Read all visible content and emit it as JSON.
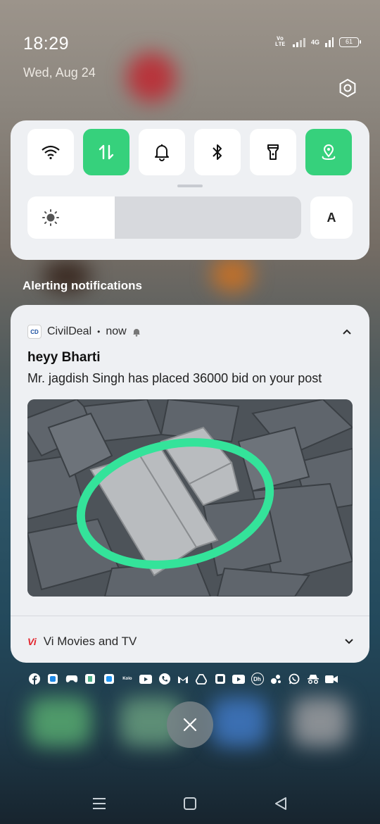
{
  "status_bar": {
    "time": "18:29",
    "date": "Wed, Aug 24",
    "volte": "Vo LTE",
    "network": "4G",
    "battery": "61"
  },
  "quick_settings": {
    "tiles": [
      {
        "name": "wifi",
        "icon": "wifi-icon",
        "active": false
      },
      {
        "name": "mobile-data",
        "icon": "mobile-data-icon",
        "active": true
      },
      {
        "name": "sound",
        "icon": "bell-icon",
        "active": false
      },
      {
        "name": "bluetooth",
        "icon": "bluetooth-icon",
        "active": false
      },
      {
        "name": "flashlight",
        "icon": "flashlight-icon",
        "active": false
      },
      {
        "name": "location",
        "icon": "location-icon",
        "active": true
      }
    ],
    "brightness_level": 0.32,
    "auto_brightness_label": "A",
    "accent_color": "#36d17c"
  },
  "section": {
    "title": "Alerting notifications"
  },
  "notification": {
    "app_logo": "CD",
    "app_name": "CivilDeal",
    "separator": "•",
    "time": "now",
    "title": "heyy Bharti",
    "body": "Mr. jagdish Singh has placed 36000 bid on your post",
    "image_icon": "paver-bricks-photo"
  },
  "notification2": {
    "app_logo": "Vi",
    "app_name": "Vi Movies and TV"
  },
  "app_icons": [
    "facebook-icon",
    "app-icon",
    "game-icon",
    "app-icon",
    "app-icon",
    "kolo-icon",
    "youtube-icon",
    "phone-icon",
    "gmail-icon",
    "drive-icon",
    "app-icon",
    "youtube-icon",
    "dailyhunt-icon",
    "app-icon",
    "whatsapp-icon",
    "incognito-icon",
    "video-icon"
  ],
  "kolo_label": "Kolo",
  "dh_label": "Dh"
}
